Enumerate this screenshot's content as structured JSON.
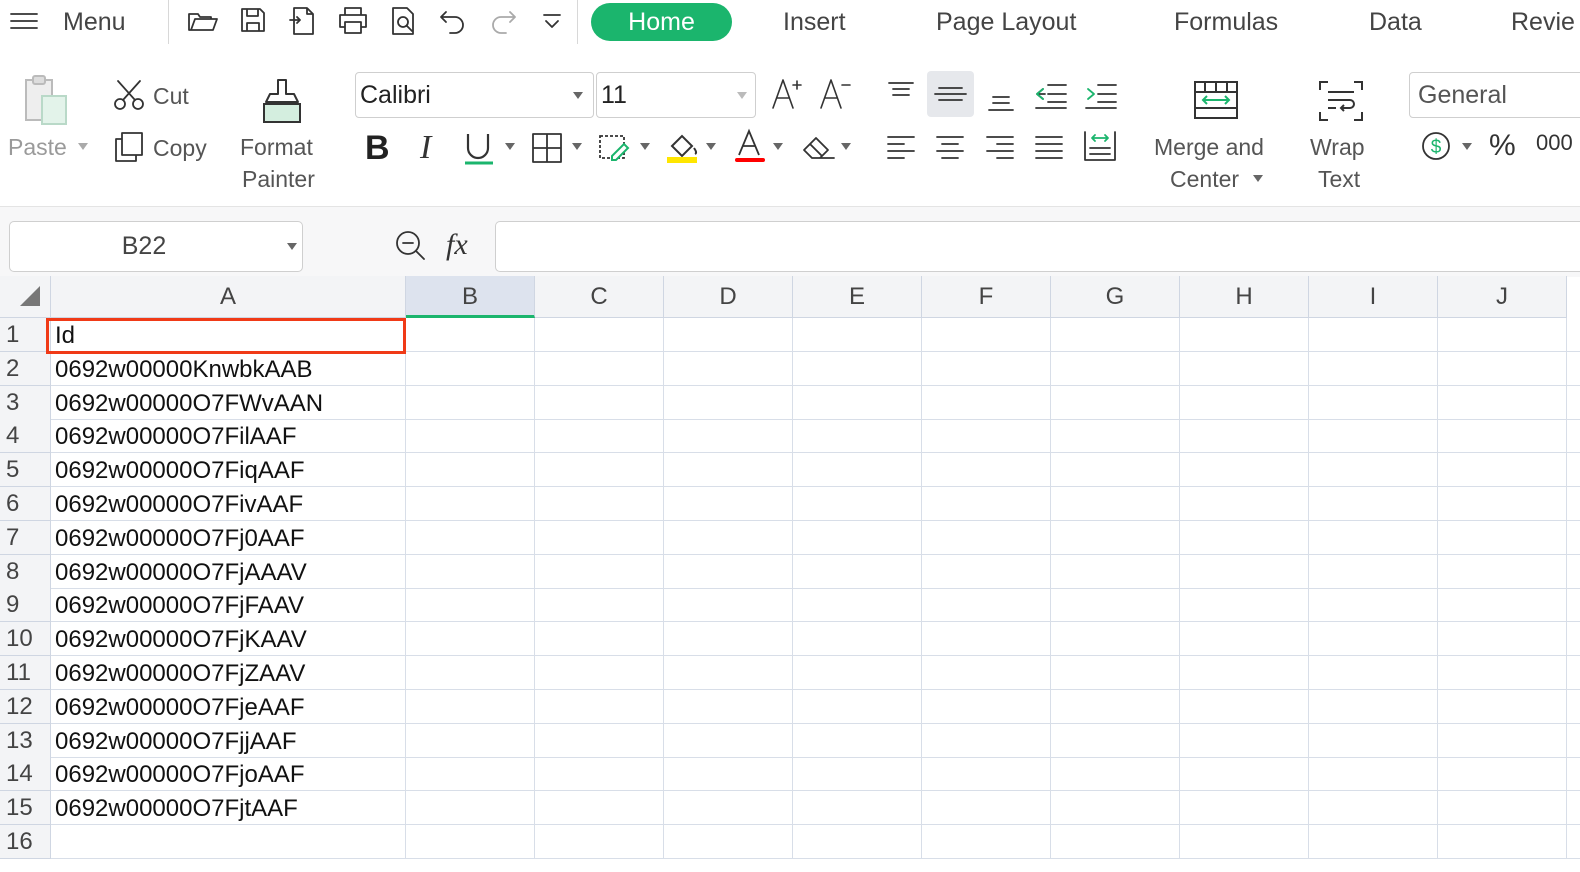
{
  "topbar": {
    "menu_label": "Menu",
    "tabs": [
      {
        "label": "Home",
        "active": true
      },
      {
        "label": "Insert"
      },
      {
        "label": "Page Layout"
      },
      {
        "label": "Formulas"
      },
      {
        "label": "Data"
      },
      {
        "label": "Revie"
      }
    ]
  },
  "ribbon": {
    "paste": "Paste",
    "cut": "Cut",
    "copy": "Copy",
    "format_painter_1": "Format",
    "format_painter_2": "Painter",
    "font_name": "Calibri",
    "font_size": "11",
    "merge_1": "Merge and",
    "merge_2": "Center",
    "wrap_1": "Wrap",
    "wrap_2": "Text",
    "number_format": "General"
  },
  "formula_bar": {
    "name_box": "B22",
    "fx": "fx",
    "value": ""
  },
  "sheet": {
    "columns": [
      "A",
      "B",
      "C",
      "D",
      "E",
      "F",
      "G",
      "H",
      "I",
      "J"
    ],
    "selected_column": "B",
    "rows": [
      {
        "num": "1",
        "a": "Id"
      },
      {
        "num": "2",
        "a": "0692w00000KnwbkAAB"
      },
      {
        "num": "3",
        "a": "0692w00000O7FWvAAN"
      },
      {
        "num": "4",
        "a": "0692w00000O7FilAAF"
      },
      {
        "num": "5",
        "a": "0692w00000O7FiqAAF"
      },
      {
        "num": "6",
        "a": "0692w00000O7FivAAF"
      },
      {
        "num": "7",
        "a": "0692w00000O7Fj0AAF"
      },
      {
        "num": "8",
        "a": "0692w00000O7FjAAAV"
      },
      {
        "num": "9",
        "a": "0692w00000O7FjFAAV"
      },
      {
        "num": "10",
        "a": "0692w00000O7FjKAAV"
      },
      {
        "num": "11",
        "a": "0692w00000O7FjZAAV"
      },
      {
        "num": "12",
        "a": "0692w00000O7FjeAAF"
      },
      {
        "num": "13",
        "a": "0692w00000O7FjjAAF"
      },
      {
        "num": "14",
        "a": "0692w00000O7FjoAAF"
      },
      {
        "num": "15",
        "a": "0692w00000O7FjtAAF"
      },
      {
        "num": "16",
        "a": ""
      }
    ]
  },
  "colors": {
    "accent": "#1bb56d",
    "highlight_border": "#f03a17",
    "font_color_underline": "#ff0000",
    "fill_color_underline": "#ffe600"
  }
}
